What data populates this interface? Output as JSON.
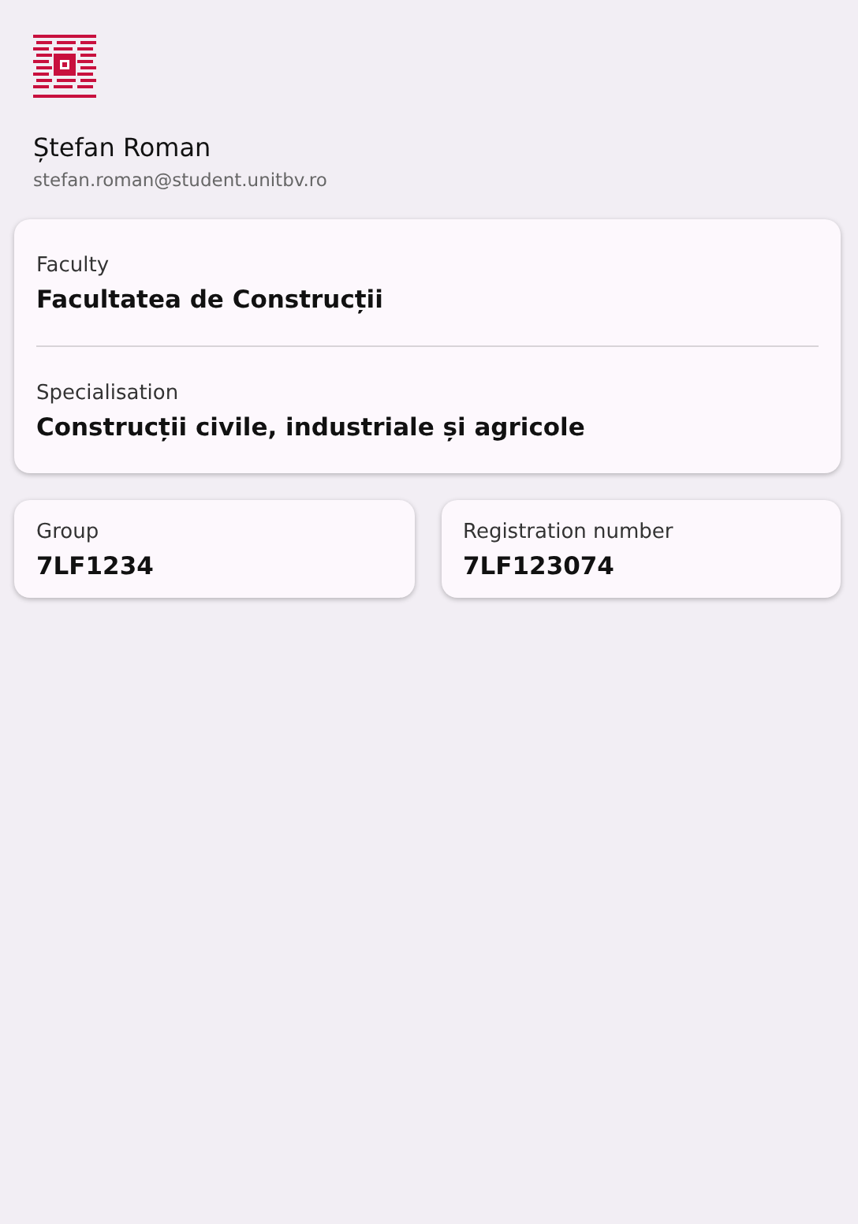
{
  "profile": {
    "name": "Ștefan Roman",
    "email": "stefan.roman@student.unitbv.ro"
  },
  "study_card": [
    {
      "label": "Faculty",
      "value": "Facultatea de Construcții"
    },
    {
      "label": "Specialisation",
      "value": "Construcții civile, industriale și agricole"
    }
  ],
  "info_cards": [
    {
      "label": "Group",
      "value": "7LF1234"
    },
    {
      "label": "Registration number",
      "value": "7LF123074"
    }
  ]
}
